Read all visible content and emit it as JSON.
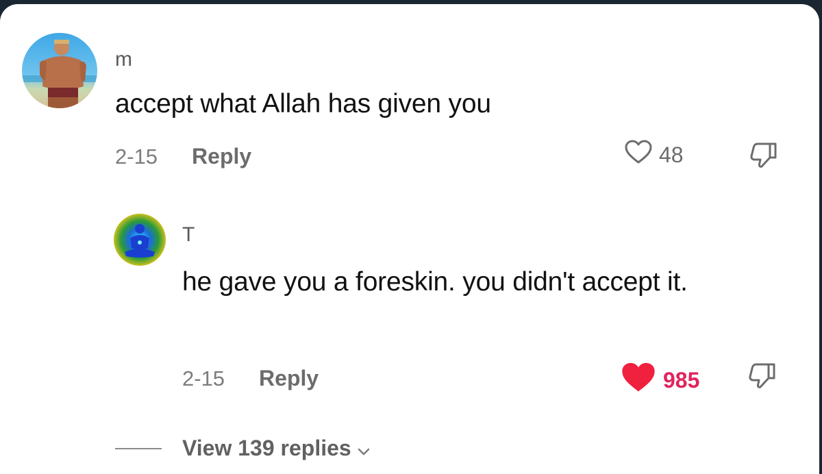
{
  "comment": {
    "username": "m",
    "text": "accept what Allah has given you",
    "date": "2-15",
    "reply_label": "Reply",
    "like_count": "48",
    "liked": false,
    "avatar_icon": "profile-photo"
  },
  "reply": {
    "username": "T",
    "text": "he gave you a foreskin. you didn't accept it.",
    "date": "2-15",
    "reply_label": "Reply",
    "like_count": "985",
    "liked": true,
    "avatar_icon": "profile-photo"
  },
  "view_replies": {
    "label": "View 139 replies",
    "icon": "chevron-down-icon"
  },
  "colors": {
    "liked_heart": "#f0203f",
    "liked_count": "#e0245e",
    "secondary_text": "#7c7c7c",
    "primary_text": "#111111"
  }
}
